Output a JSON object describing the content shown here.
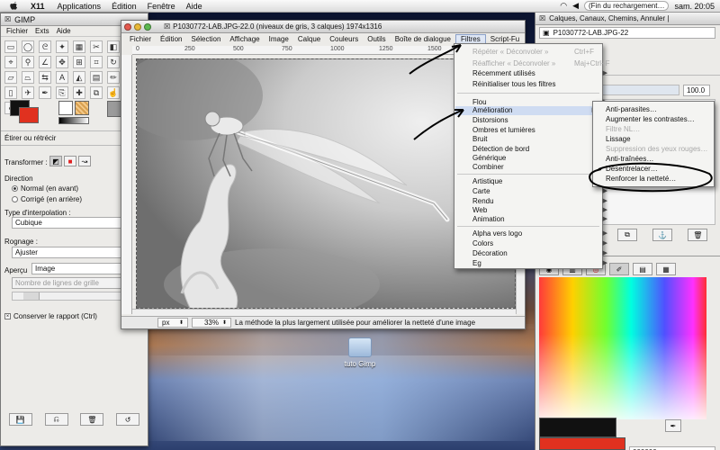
{
  "menubar": {
    "app": "X11",
    "items": [
      "Applications",
      "Édition",
      "Fenêtre",
      "Aide"
    ],
    "status": "(Fin du rechargement…",
    "clock": "sam. 20:05"
  },
  "toolbox": {
    "title": "GIMP",
    "menu": [
      "Fichier",
      "Exts",
      "Aide"
    ],
    "tool_title": "Étirer ou rétrécir",
    "transform_label": "Transformer :",
    "direction_label": "Direction",
    "direction_normal": "Normal (en avant)",
    "direction_corrective": "Corrigé (en arrière)",
    "interp_label": "Type d'interpolation :",
    "interp_value": "Cubique",
    "clipping_label": "Rognage :",
    "clipping_value": "Ajuster",
    "preview_label": "Aperçu",
    "preview_value": "Image",
    "grid_lines_value": "Nombre de lignes de grille",
    "keep_ratio": "Conserver le rapport (Ctrl)"
  },
  "image_window": {
    "title": "P1030772-LAB.JPG-22.0 (niveaux de gris, 3 calques) 1974x1316",
    "menu": [
      "Fichier",
      "Édition",
      "Sélection",
      "Affichage",
      "Image",
      "Calque",
      "Couleurs",
      "Outils",
      "Boîte de dialogue",
      "Filtres",
      "Script-Fu"
    ],
    "ruler_ticks": [
      "0",
      "250",
      "500",
      "750",
      "1000",
      "1250",
      "1500"
    ],
    "status_unit": "px",
    "status_zoom": "33%",
    "status_message": "La méthode la plus largement utilisée pour améliorer la netteté d'une image"
  },
  "filters_menu": {
    "items": [
      {
        "label": "Répéter « Déconvoler »",
        "shortcut": "Ctrl+F",
        "dim": true
      },
      {
        "label": "Réafficher « Déconvoler »",
        "shortcut": "Maj+Ctrl+F",
        "dim": true
      },
      {
        "label": "Récemment utilisés",
        "submenu": true
      },
      {
        "label": "Réinitialiser tous les filtres"
      },
      {
        "label": "Flou",
        "submenu": true
      },
      {
        "label": "Amélioration",
        "submenu": true,
        "highlight": true
      },
      {
        "label": "Distorsions",
        "submenu": true
      },
      {
        "label": "Ombres et lumières",
        "submenu": true
      },
      {
        "label": "Bruit",
        "submenu": true
      },
      {
        "label": "Détection de bord",
        "submenu": true
      },
      {
        "label": "Générique",
        "submenu": true
      },
      {
        "label": "Combiner",
        "submenu": true
      },
      {
        "label": "Artistique",
        "submenu": true
      },
      {
        "label": "Carte",
        "submenu": true
      },
      {
        "label": "Rendu",
        "submenu": true
      },
      {
        "label": "Web",
        "submenu": true
      },
      {
        "label": "Animation",
        "submenu": true
      },
      {
        "label": "Alpha vers logo",
        "submenu": true
      },
      {
        "label": "Colors",
        "submenu": true
      },
      {
        "label": "Décoration",
        "submenu": true
      },
      {
        "label": "Eg",
        "submenu": true
      }
    ]
  },
  "submenu": {
    "items": [
      {
        "label": "Anti-parasites…"
      },
      {
        "label": "Augmenter les contrastes…"
      },
      {
        "label": "Filtre NL…",
        "dim": true
      },
      {
        "label": "Lissage"
      },
      {
        "label": "Suppression des yeux rouges…",
        "dim": true
      },
      {
        "label": "Anti-traînées…"
      },
      {
        "label": "Désentrelacer…"
      },
      {
        "label": "Renforcer la netteté…",
        "circled": true
      }
    ]
  },
  "dock": {
    "title": "Calques, Canaux, Chemins, Annuler |",
    "image_combo": "P1030772-LAB.JPG-22",
    "opacity": "100.0",
    "hex": "000000"
  },
  "desktop": {
    "folder_label": "tuto Gimp"
  },
  "colors": {
    "fg": "#111111",
    "bg": "#e0311f",
    "menu_highlight": "#cfdcf2"
  }
}
